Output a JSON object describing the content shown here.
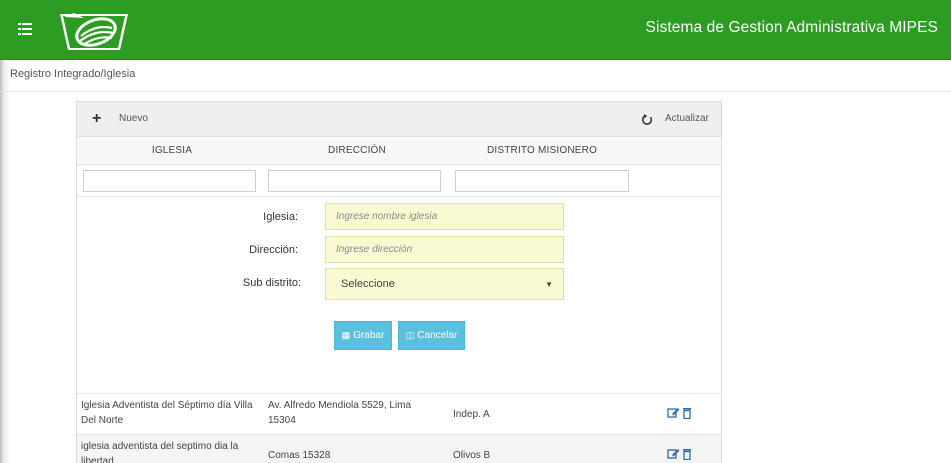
{
  "header": {
    "title": "Sistema de Gestion Administrativa MIPES",
    "brand_color": "#2d9c22"
  },
  "breadcrumb": "Registro Integrado/Iglesia",
  "toolbar": {
    "new_label": "Nuevo",
    "new_icon": "plus-icon",
    "refresh_label": "Actualizar",
    "refresh_icon": "refresh-icon"
  },
  "table": {
    "columns": [
      "IGLESIA",
      "DIRECCIÓN",
      "DISTRITO MISIONERO"
    ],
    "rows": [
      {
        "iglesia": [
          "Iglesia Adventista del Séptimo día Villa",
          "Del Norte"
        ],
        "direccion": [
          "Av. Alfredo Mendiola 5529, Lima",
          "15304"
        ],
        "distrito": "Indep. A"
      },
      {
        "iglesia": [
          "iglesia adventista del septimo dia la",
          "libertad"
        ],
        "direccion": [
          "Comas 15328",
          ""
        ],
        "distrito": "Olivos B"
      }
    ]
  },
  "form": {
    "iglesia_label": "Iglesia:",
    "iglesia_placeholder": "Ingrese nombre iglesia",
    "direccion_label": "Dirección:",
    "direccion_placeholder": "Ingrese dirección",
    "subdistrito_label": "Sub distrito:",
    "subdistrito_selected": "Seleccione",
    "save_label": "Grabar",
    "cancel_label": "Cancelar",
    "field_bg": "#fafad2",
    "button_color": "#5bc0de"
  }
}
